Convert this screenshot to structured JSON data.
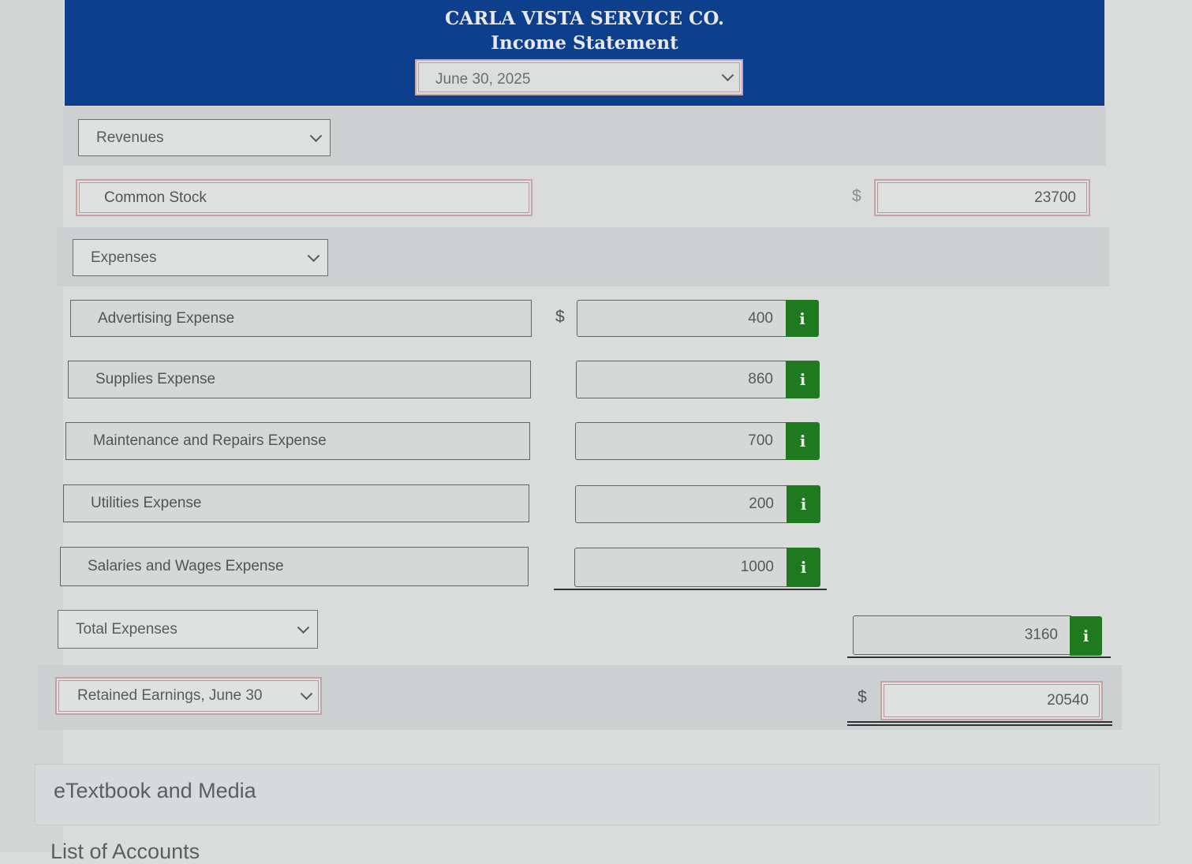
{
  "header": {
    "company": "CARLA VISTA SERVICE CO.",
    "statement": "Income Statement",
    "date_select": "June 30, 2025"
  },
  "revenues": {
    "section_select": "Revenues",
    "line_item": "Common Stock",
    "currency": "$",
    "amount": "23700"
  },
  "expenses": {
    "section_select": "Expenses",
    "currency": "$",
    "items": [
      {
        "label": "Advertising Expense",
        "amount": "400",
        "info": "i"
      },
      {
        "label": "Supplies Expense",
        "amount": "860",
        "info": "i"
      },
      {
        "label": "Maintenance and Repairs Expense",
        "amount": "700",
        "info": "i"
      },
      {
        "label": "Utilities Expense",
        "amount": "200",
        "info": "i"
      },
      {
        "label": "Salaries and Wages Expense",
        "amount": "1000",
        "info": "i"
      }
    ],
    "total_select": "Total Expenses",
    "total_amount": "3160",
    "total_info": "i"
  },
  "result": {
    "select": "Retained Earnings, June 30",
    "currency": "$",
    "amount": "20540"
  },
  "footer": {
    "media_label": "eTextbook and Media",
    "accounts_label": "List of Accounts"
  },
  "colors": {
    "header_bg": "#0d3f8c",
    "info_button": "#1f7a1f",
    "error_border": "#c7a2a5"
  }
}
